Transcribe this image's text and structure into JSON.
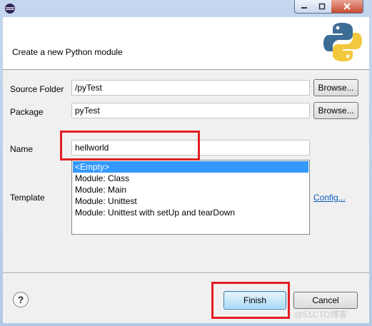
{
  "header": {
    "title": "Create a new Python module"
  },
  "form": {
    "source_folder_label": "Source Folder",
    "source_folder_value": "/pyTest",
    "package_label": "Package",
    "package_value": "pyTest",
    "name_label": "Name",
    "name_value": "hellworld",
    "template_label": "Template",
    "browse_label": "Browse...",
    "config_link": "Config..."
  },
  "templates": [
    {
      "label": "<Empty>",
      "selected": true
    },
    {
      "label": "Module: Class",
      "selected": false
    },
    {
      "label": "Module: Main",
      "selected": false
    },
    {
      "label": "Module: Unittest",
      "selected": false
    },
    {
      "label": "Module: Unittest with setUp and tearDown",
      "selected": false
    }
  ],
  "buttons": {
    "finish": "Finish",
    "cancel": "Cancel",
    "help": "?"
  },
  "watermark": "@51CTO博客",
  "colors": {
    "highlight": "#e21e24",
    "selection": "#3399ff",
    "link": "#0b5bbd"
  },
  "icons": {
    "app": "eclipse-icon",
    "logo": "python-logo-icon"
  }
}
